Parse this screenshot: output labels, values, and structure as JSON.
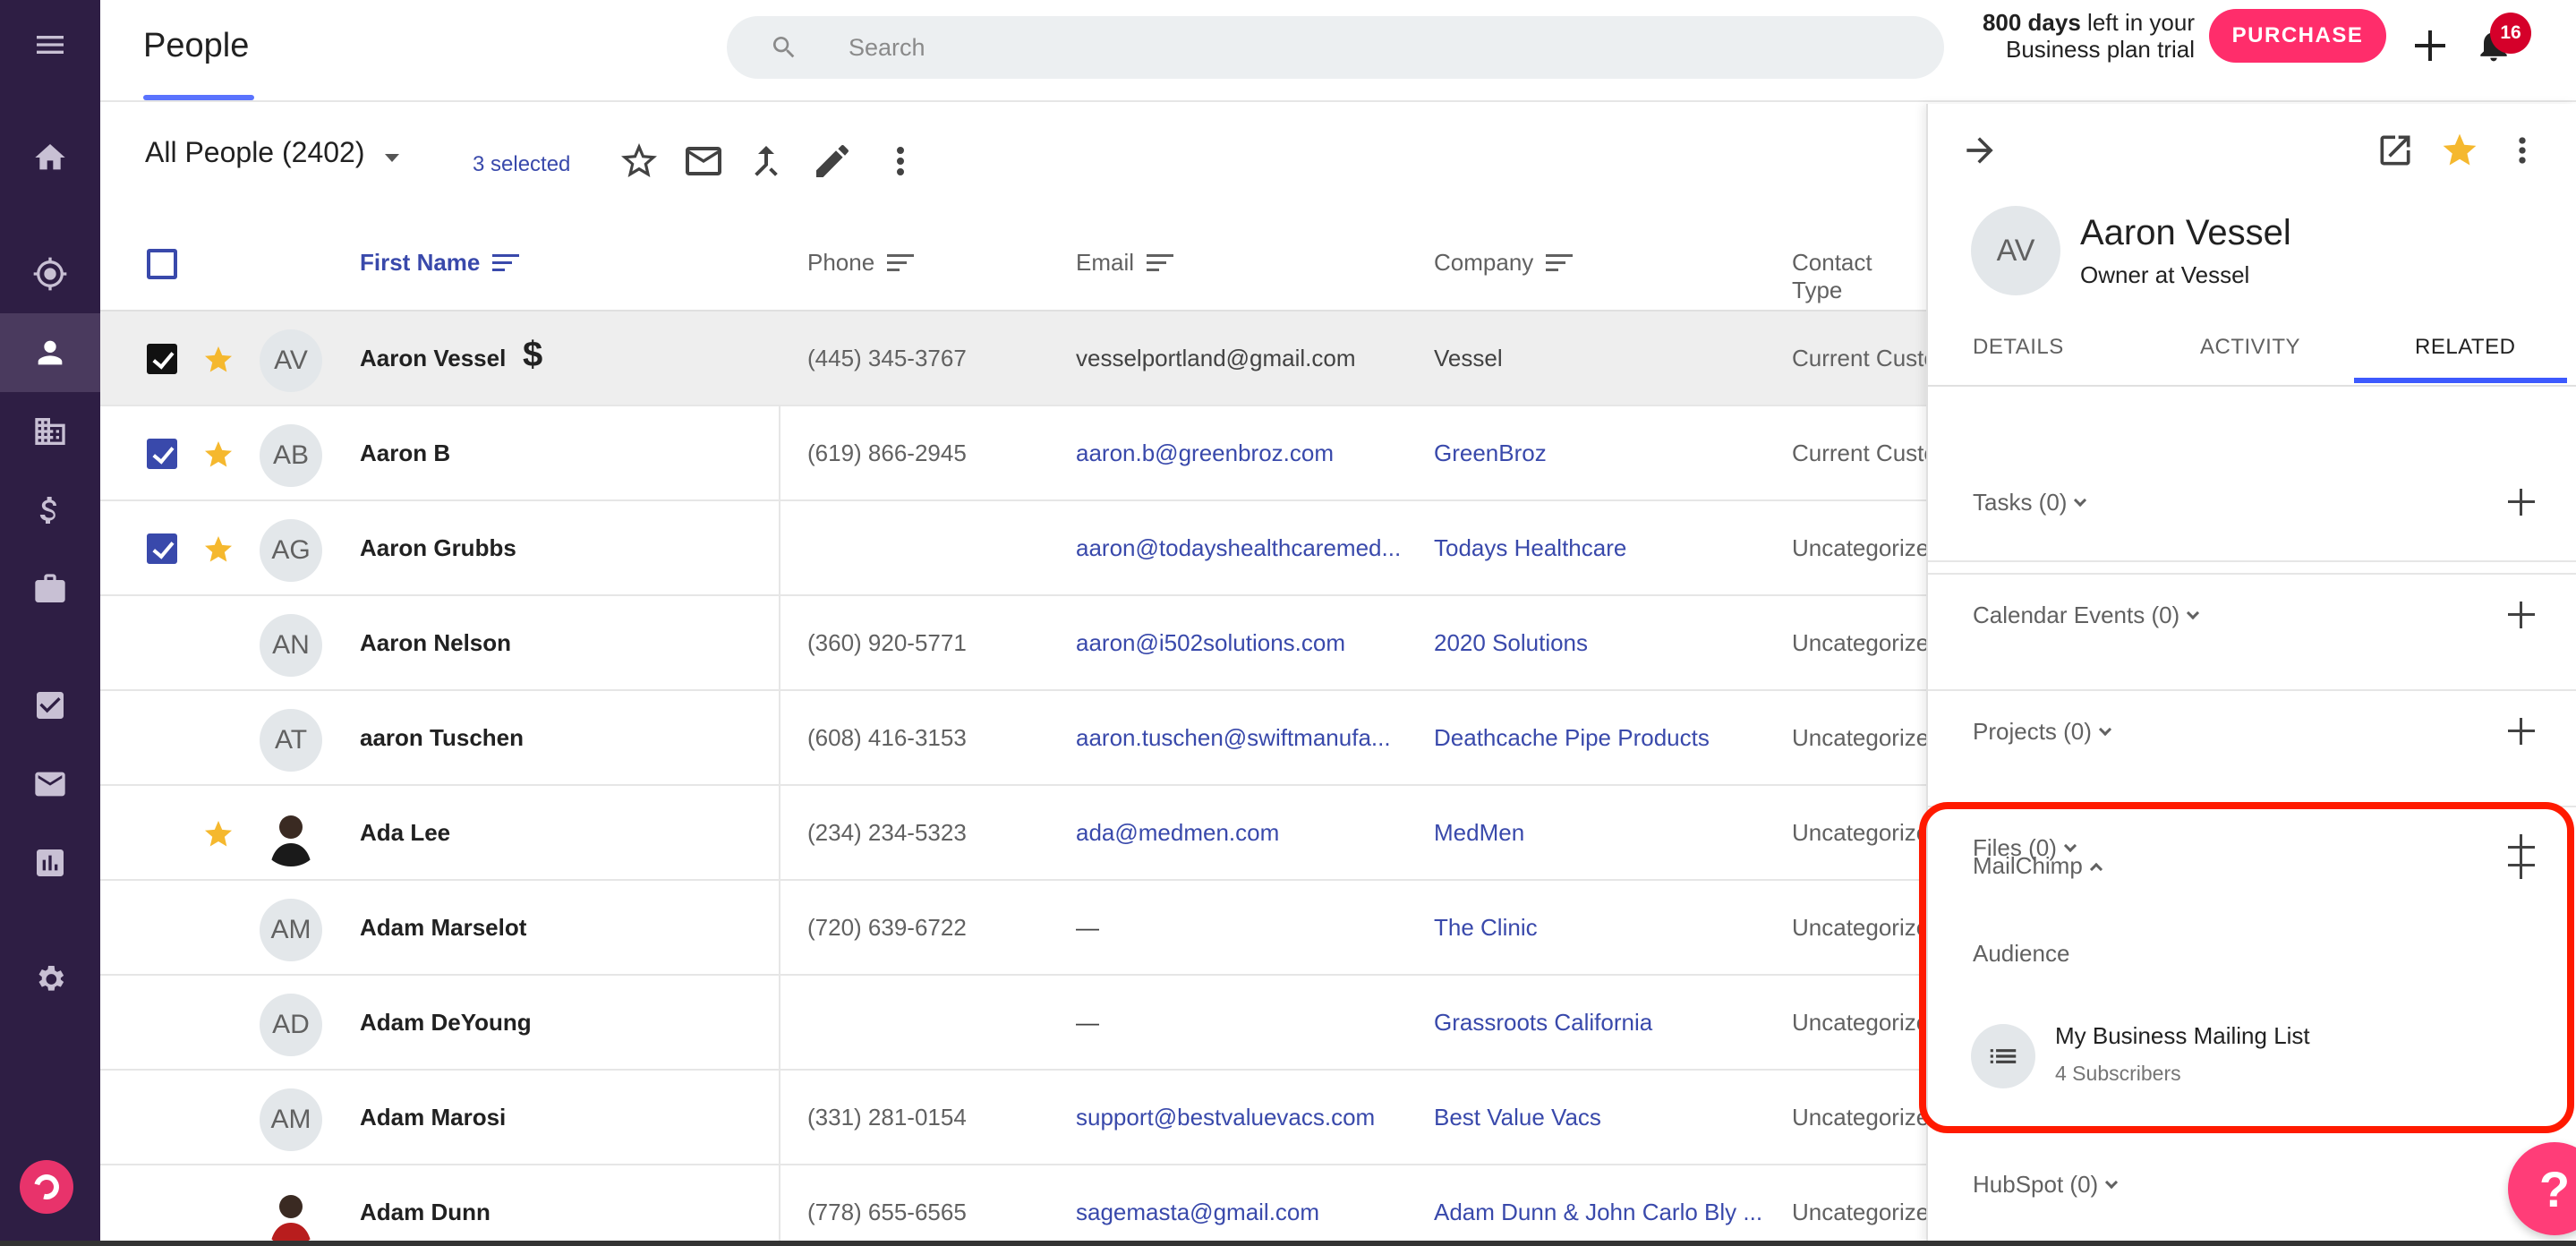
{
  "header": {
    "title": "People",
    "search_placeholder": "Search",
    "trial_days": "800 days",
    "trial_text": "left in your Business plan trial",
    "purchase_label": "PURCHASE",
    "notification_count": "16"
  },
  "toolbar": {
    "view_label": "All People (2402)",
    "selected_label": "3 selected"
  },
  "table": {
    "columns": [
      "First Name",
      "Phone",
      "Email",
      "Company",
      "Contact Type"
    ],
    "rows": [
      {
        "initials": "AV",
        "name": "Aaron Vessel",
        "phone": "(445) 345-3767",
        "email": "vesselportland@gmail.com",
        "company": "Vessel",
        "type": "Current Custo",
        "starred": true,
        "checked": true
      },
      {
        "initials": "AB",
        "name": "Aaron B",
        "phone": "(619) 866-2945",
        "email": "aaron.b@greenbroz.com",
        "company": "GreenBroz",
        "type": "Current Custo",
        "starred": true,
        "checked": true
      },
      {
        "initials": "AG",
        "name": "Aaron Grubbs",
        "phone": "",
        "email": "aaron@todayshealthcaremed...",
        "company": "Todays Healthcare",
        "type": "Uncategorize",
        "starred": true,
        "checked": true
      },
      {
        "initials": "AN",
        "name": "Aaron Nelson",
        "phone": "(360) 920-5771",
        "email": "aaron@i502solutions.com",
        "company": "2020 Solutions",
        "type": "Uncategorize",
        "starred": false,
        "checked": false
      },
      {
        "initials": "AT",
        "name": "aaron Tuschen",
        "phone": "(608) 416-3153",
        "email": "aaron.tuschen@swiftmanufa...",
        "company": "Deathcache Pipe Products",
        "type": "Uncategorize",
        "starred": false,
        "checked": false
      },
      {
        "initials": "",
        "name": "Ada Lee",
        "phone": "(234) 234-5323",
        "email": "ada@medmen.com",
        "company": "MedMen",
        "type": "Uncategorize",
        "starred": true,
        "checked": false
      },
      {
        "initials": "AM",
        "name": "Adam Marselot",
        "phone": "(720) 639-6722",
        "email": "—",
        "company": "The Clinic",
        "type": "Uncategorize",
        "starred": false,
        "checked": false
      },
      {
        "initials": "AD",
        "name": "Adam DeYoung",
        "phone": "",
        "email": "—",
        "company": "Grassroots California",
        "type": "Uncategorize",
        "starred": false,
        "checked": false
      },
      {
        "initials": "AM",
        "name": "Adam Marosi",
        "phone": "(331) 281-0154",
        "email": "support@bestvaluevacs.com",
        "company": "Best Value Vacs",
        "type": "Uncategorize",
        "starred": false,
        "checked": false
      },
      {
        "initials": "",
        "name": "Adam Dunn",
        "phone": "(778) 655-6565",
        "email": "sagemasta@gmail.com",
        "company": "Adam Dunn & John Carlo Bly ...",
        "type": "Uncategorize",
        "starred": false,
        "checked": false
      }
    ]
  },
  "panel": {
    "initials": "AV",
    "name": "Aaron Vessel",
    "subtitle": "Owner at Vessel",
    "tabs": [
      "DETAILS",
      "ACTIVITY",
      "RELATED"
    ],
    "sections": {
      "tasks": "Tasks (0)",
      "calendar": "Calendar Events (0)",
      "projects": "Projects (0)",
      "files": "Files (0)",
      "mailchimp": "MailChimp",
      "hubspot": "HubSpot (0)"
    },
    "audience_label": "Audience",
    "list_name": "My Business Mailing List",
    "list_subscribers": "4 Subscribers"
  },
  "help_label": "?",
  "colors": {
    "nav_bg": "#2e1e44",
    "accent": "#3d5afe",
    "link": "#3949ab",
    "purchase": "#ff2d6b",
    "star": "#f5b82e",
    "highlight": "#ff1a00"
  }
}
